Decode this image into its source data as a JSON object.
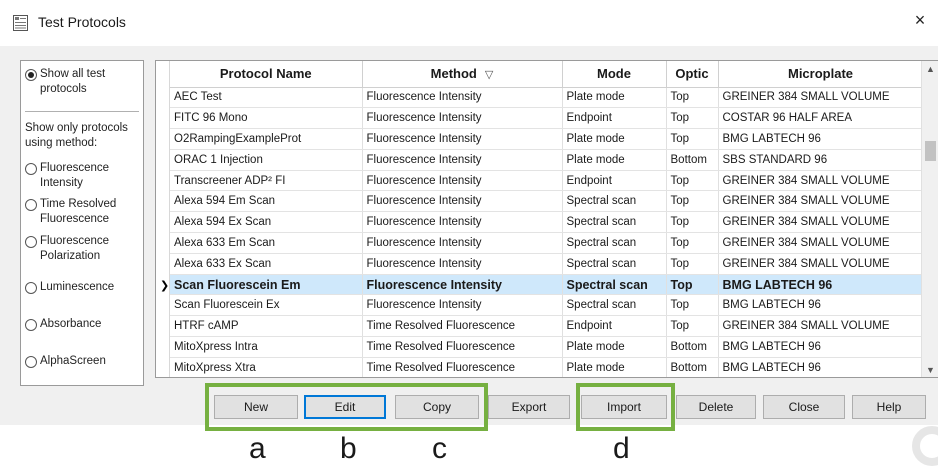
{
  "window": {
    "title": "Test Protocols",
    "close_label": "×"
  },
  "filter": {
    "show_all_label": "Show all test protocols",
    "caption": "Show only protocols using method:",
    "methods": [
      {
        "label": "Fluorescence Intensity"
      },
      {
        "label": "Time Resolved Fluorescence"
      },
      {
        "label": "Fluorescence Polarization"
      },
      {
        "label": "Luminescence"
      },
      {
        "label": "Absorbance"
      },
      {
        "label": "AlphaScreen"
      }
    ]
  },
  "table": {
    "columns": [
      "Protocol Name",
      "Method",
      "Mode",
      "Optic",
      "Microplate"
    ],
    "sort_indicator": "▽",
    "pointer": "❯",
    "rows": [
      {
        "name": "AEC Test",
        "method": "Fluorescence Intensity",
        "mode": "Plate mode",
        "optic": "Top",
        "microplate": "GREINER 384 SMALL VOLUME"
      },
      {
        "name": "FITC 96 Mono",
        "method": "Fluorescence Intensity",
        "mode": "Endpoint",
        "optic": "Top",
        "microplate": "COSTAR 96 HALF AREA"
      },
      {
        "name": "O2RampingExampleProt",
        "method": "Fluorescence Intensity",
        "mode": "Plate mode",
        "optic": "Top",
        "microplate": "BMG LABTECH 96"
      },
      {
        "name": "ORAC 1 Injection",
        "method": "Fluorescence Intensity",
        "mode": "Plate mode",
        "optic": "Bottom",
        "microplate": "SBS STANDARD 96"
      },
      {
        "name": "Transcreener ADP² FI",
        "method": "Fluorescence Intensity",
        "mode": "Endpoint",
        "optic": "Top",
        "microplate": "GREINER 384 SMALL VOLUME"
      },
      {
        "name": "Alexa 594 Em Scan",
        "method": "Fluorescence Intensity",
        "mode": "Spectral scan",
        "optic": "Top",
        "microplate": "GREINER 384 SMALL VOLUME"
      },
      {
        "name": "Alexa 594 Ex Scan",
        "method": "Fluorescence Intensity",
        "mode": "Spectral scan",
        "optic": "Top",
        "microplate": "GREINER 384 SMALL VOLUME"
      },
      {
        "name": "Alexa 633 Em Scan",
        "method": "Fluorescence Intensity",
        "mode": "Spectral scan",
        "optic": "Top",
        "microplate": "GREINER 384 SMALL VOLUME"
      },
      {
        "name": "Alexa 633 Ex Scan",
        "method": "Fluorescence Intensity",
        "mode": "Spectral scan",
        "optic": "Top",
        "microplate": "GREINER 384 SMALL VOLUME"
      },
      {
        "name": "Scan Fluorescein Em",
        "method": "Fluorescence Intensity",
        "mode": "Spectral scan",
        "optic": "Top",
        "microplate": "BMG LABTECH 96"
      },
      {
        "name": "Scan Fluorescein Ex",
        "method": "Fluorescence Intensity",
        "mode": "Spectral scan",
        "optic": "Top",
        "microplate": "BMG LABTECH 96"
      },
      {
        "name": "HTRF cAMP",
        "method": "Time Resolved Fluorescence",
        "mode": "Endpoint",
        "optic": "Top",
        "microplate": "GREINER 384 SMALL VOLUME"
      },
      {
        "name": "MitoXpress Intra",
        "method": "Time Resolved Fluorescence",
        "mode": "Plate mode",
        "optic": "Bottom",
        "microplate": "BMG LABTECH 96"
      },
      {
        "name": "MitoXpress Xtra",
        "method": "Time Resolved Fluorescence",
        "mode": "Plate mode",
        "optic": "Bottom",
        "microplate": "BMG LABTECH 96"
      }
    ]
  },
  "buttons": {
    "new": "New",
    "edit": "Edit",
    "copy": "Copy",
    "export": "Export",
    "import": "Import",
    "delete": "Delete",
    "close": "Close",
    "help": "Help"
  },
  "annotations": {
    "a": "a",
    "b": "b",
    "c": "c",
    "d": "d"
  },
  "colors": {
    "highlight": "#76b041",
    "selected_row": "#cfe8fb",
    "focus": "#0078d7"
  }
}
